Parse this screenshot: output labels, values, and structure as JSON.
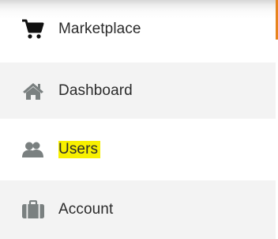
{
  "nav": {
    "items": [
      {
        "label": "Marketplace",
        "icon": "cart-icon",
        "active": true
      },
      {
        "label": "Dashboard",
        "icon": "home-icon"
      },
      {
        "label": "Users",
        "icon": "users-icon",
        "highlighted": true
      },
      {
        "label": "Account",
        "icon": "briefcase-icon"
      }
    ]
  },
  "colors": {
    "accent": "#e8841e",
    "highlight": "#f7f000",
    "icon_active": "#111111",
    "icon_muted": "#7a8080"
  }
}
